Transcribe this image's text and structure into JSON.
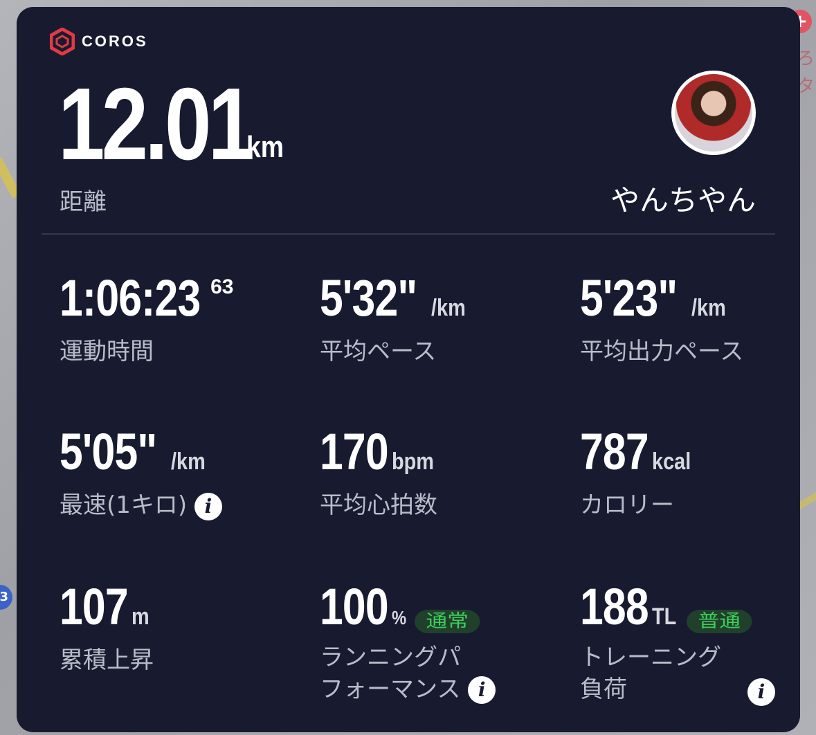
{
  "brand": {
    "name": "COROS",
    "accent": "#e03a43"
  },
  "distance": {
    "value": "12.01",
    "unit": "km",
    "label": "距離"
  },
  "user": {
    "name": "やんちやん"
  },
  "stats": [
    {
      "value": "1:06:23",
      "sup": "63",
      "unit": "",
      "label": "運動時間"
    },
    {
      "value": "5'32\"",
      "unit": "/km",
      "label": "平均ペース"
    },
    {
      "value": "5'23\"",
      "unit": "/km",
      "label": "平均出力ペース"
    },
    {
      "value": "5'05\"",
      "unit": "/km",
      "label": "最速(1キロ)"
    },
    {
      "value": "170",
      "unit": "bpm",
      "label": "平均心拍数"
    },
    {
      "value": "787",
      "unit": "kcal",
      "label": "カロリー"
    },
    {
      "value": "107",
      "unit": "m",
      "label": "累積上昇"
    },
    {
      "value": "100",
      "unit": "%",
      "badge": "通常",
      "label_line1": "ランニングパ",
      "label_line2": "フォーマンス"
    },
    {
      "value": "188",
      "unit": "TL",
      "badge": "普通",
      "label_line1": "トレーニング",
      "label_line2": "負荷"
    }
  ],
  "info_icon": "i",
  "map": {
    "plus": "+",
    "route_marker": "3",
    "text_1": "ろ",
    "text_2": "タ"
  }
}
